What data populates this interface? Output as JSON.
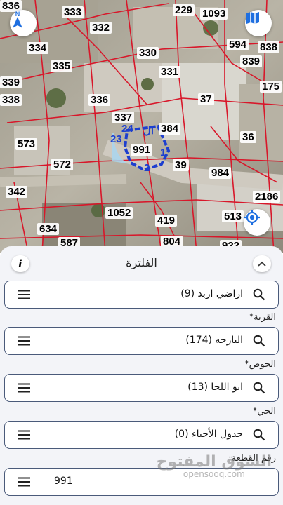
{
  "map": {
    "parcels": [
      "836",
      "333",
      "229",
      "1093",
      "332",
      "594",
      "838",
      "334",
      "330",
      "839",
      "335",
      "331",
      "339",
      "175",
      "338",
      "336",
      "37",
      "337",
      "384",
      "573",
      "36",
      "991",
      "572",
      "39",
      "984",
      "342",
      "2186",
      "1052",
      "419",
      "513",
      "634",
      "587",
      "804",
      "922"
    ],
    "highlight_labels": [
      "24",
      "23",
      "1",
      "2"
    ],
    "partial_label": "ال"
  },
  "filter": {
    "title": "الفلترة",
    "info_label": "i",
    "fields": [
      {
        "label": "",
        "value": "اراضي اربد (9)"
      },
      {
        "label": "القرية*",
        "value": "البارحه (174)"
      },
      {
        "label": "الحوض*",
        "value": "ابو اللجا (13)"
      },
      {
        "label": "الحي*",
        "value": "جدول الأحياء (0)"
      },
      {
        "label": "رقم القطعة",
        "value": "991"
      }
    ]
  },
  "watermark": {
    "arabic": "السوق المفتوح",
    "latin": "opensooq.com"
  },
  "colors": {
    "accent": "#1f6fe0",
    "parcel_line": "#d8172a",
    "highlight": "#1d3fcf"
  }
}
